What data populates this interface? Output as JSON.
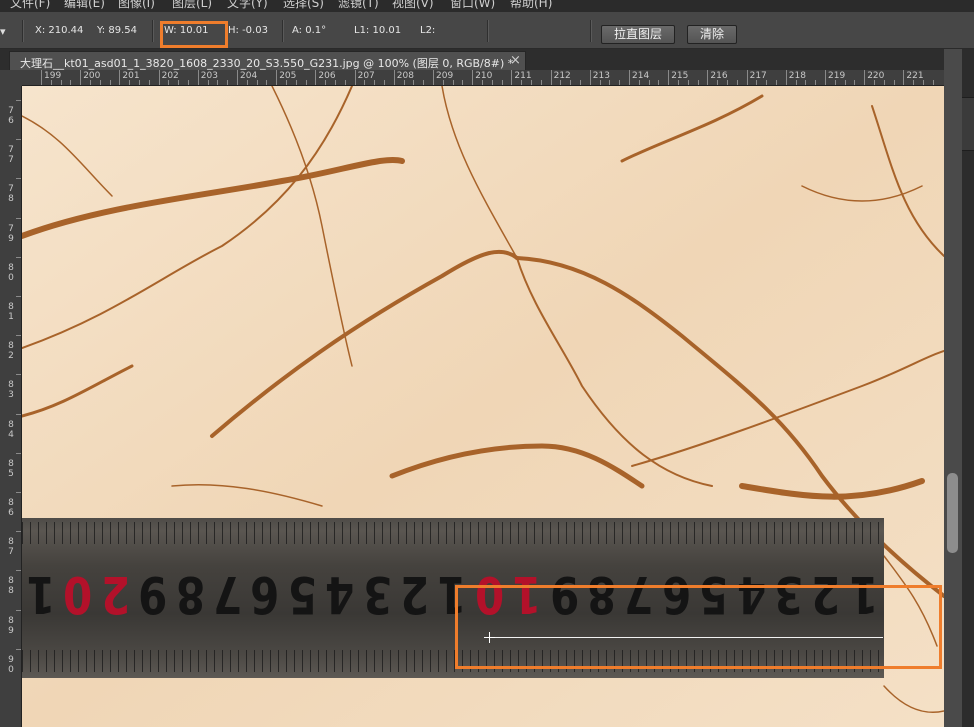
{
  "menu": [
    {
      "label": "文件(F)"
    },
    {
      "label": "编辑(E)"
    },
    {
      "label": "图像(I)"
    },
    {
      "label": "图层(L)"
    },
    {
      "label": "文字(Y)"
    },
    {
      "label": "选择(S)"
    },
    {
      "label": "滤镜(T)"
    },
    {
      "label": "视图(V)"
    },
    {
      "label": "窗口(W)"
    },
    {
      "label": "帮助(H)"
    }
  ],
  "options": {
    "tool_indicator": "▾",
    "x": "X: 210.44",
    "y": "Y: 89.54",
    "w": "W: 10.01",
    "h": "H: -0.03",
    "a": "A: 0.1°",
    "l1": "L1: 10.01",
    "l2": "L2:",
    "straighten_button": "拉直图层",
    "clear_button": "清除"
  },
  "document": {
    "tab_title": "大理石__kt01_asd01_1_3820_1608_2330_20_S3.550_G231.jpg @ 100% (图层 0, RGB/8#) *",
    "close_glyph": "×"
  },
  "hruler_labels": [
    "199",
    "200",
    "201",
    "202",
    "203",
    "204",
    "205",
    "206",
    "207",
    "208",
    "209",
    "210",
    "211",
    "212",
    "213",
    "214",
    "215",
    "216",
    "217",
    "218",
    "219",
    "220",
    "221"
  ],
  "vruler_labels": [
    "76",
    "77",
    "78",
    "79",
    "80",
    "81",
    "82",
    "83",
    "84",
    "85",
    "86",
    "87",
    "88",
    "89",
    "90"
  ],
  "ruler_photo_digits": [
    "1",
    "0",
    "2",
    "9",
    "8",
    "7",
    "6",
    "5",
    "4",
    "3",
    "2",
    "1",
    "0",
    "1",
    "9",
    "8",
    "7",
    "6",
    "5",
    "4",
    "3",
    "2",
    "1"
  ],
  "colors": {
    "highlight": "#ef7d2c",
    "marble_vein": "#9b5a24",
    "ruler_red": "#b3112a"
  }
}
